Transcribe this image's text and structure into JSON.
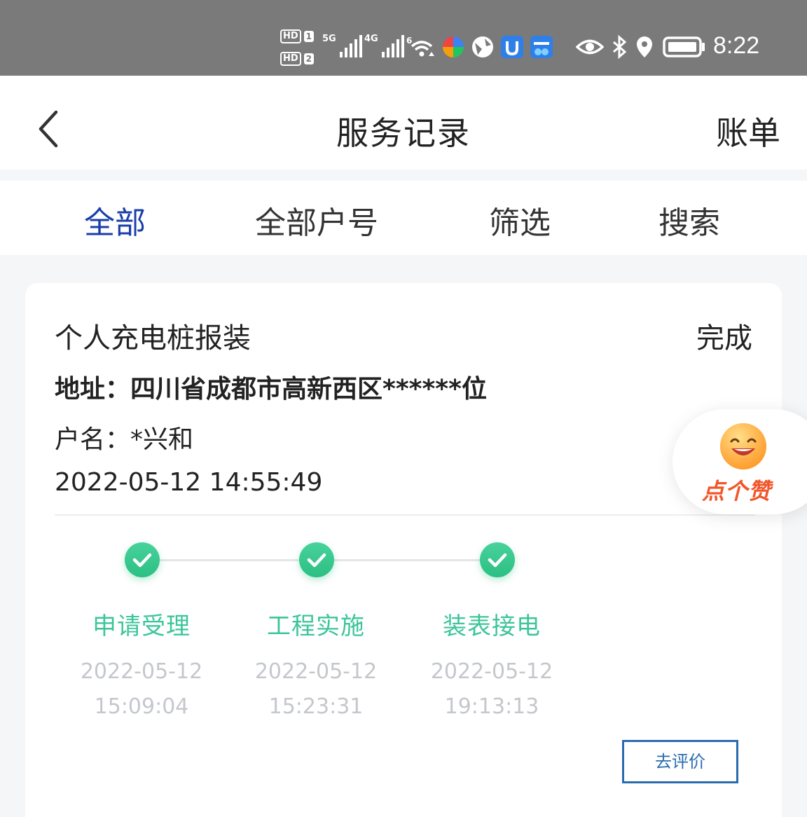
{
  "status_bar": {
    "hd1": "HD",
    "hd1_num": "1",
    "hd2": "HD",
    "hd2_num": "2",
    "net1": "5G",
    "net2": "4G",
    "wifi": "6",
    "time": "8:22",
    "bg_color": "#7a7a7a"
  },
  "header": {
    "title": "服务记录",
    "right_link": "账单"
  },
  "tabs": [
    {
      "label": "全部",
      "active": true
    },
    {
      "label": "全部户号",
      "active": false
    },
    {
      "label": "筛选",
      "active": false
    },
    {
      "label": "搜索",
      "active": false
    }
  ],
  "record": {
    "service": "个人充电桩报装",
    "status": "完成",
    "address": "地址：四川省成都市高新西区******位",
    "name": "户名：*兴和",
    "created": "2022-05-12 14:55:49",
    "steps": [
      {
        "label": "申请受理",
        "date": "2022-05-12",
        "time": "15:09:04"
      },
      {
        "label": "工程实施",
        "date": "2022-05-12",
        "time": "15:23:31"
      },
      {
        "label": "装表接电",
        "date": "2022-05-12",
        "time": "19:13:13"
      }
    ],
    "rate_button": "去评价"
  },
  "like_badge": {
    "label": "点个赞"
  },
  "colors": {
    "accent_tab": "#1a3ea8",
    "step_green": "#3cc59a",
    "button_blue": "#2a6bb0",
    "like_orange": "#f0562b"
  }
}
